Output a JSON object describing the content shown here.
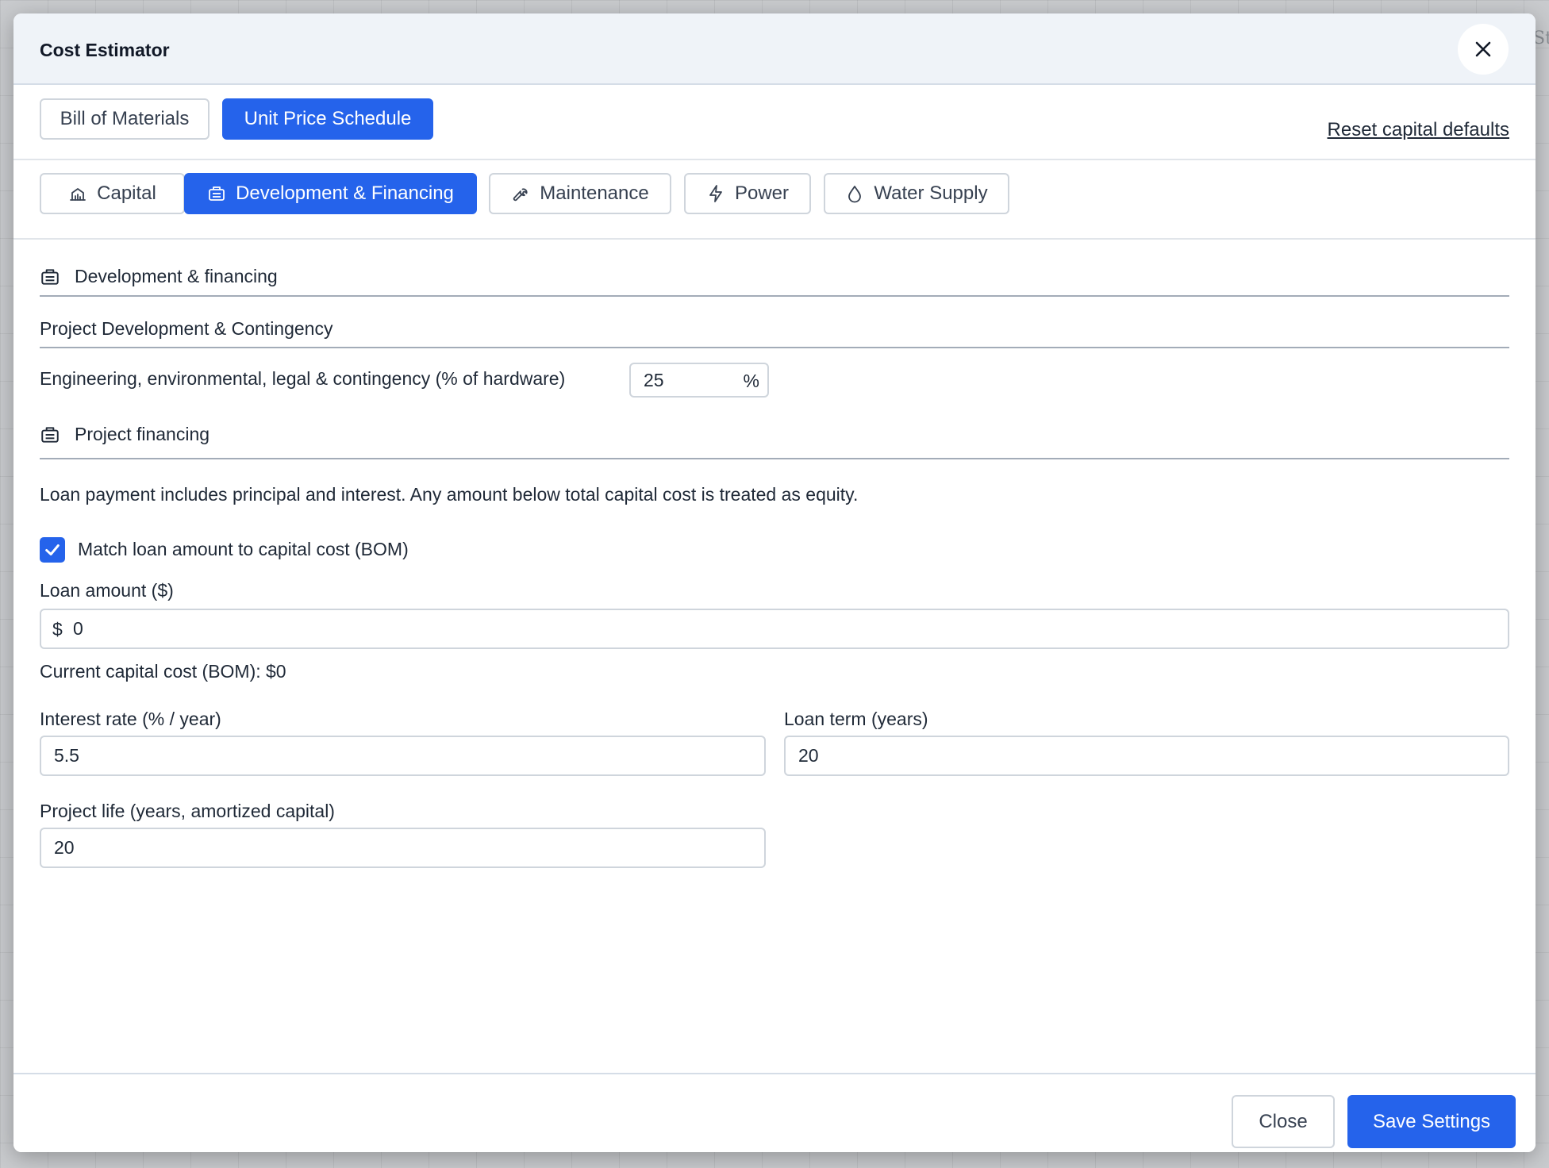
{
  "background": {
    "corner_text": "St"
  },
  "modal": {
    "title": "Cost Estimator",
    "close_icon": "close-icon"
  },
  "top_tabs": {
    "items": [
      {
        "label": "Bill of Materials",
        "active": false
      },
      {
        "label": "Unit Price Schedule",
        "active": true
      }
    ],
    "reset_link": "Reset capital defaults"
  },
  "sub_tabs": {
    "items": [
      {
        "label": "Capital",
        "icon": "building-bank-icon",
        "active": false
      },
      {
        "label": "Development & Financing",
        "icon": "briefcase-icon",
        "active": true
      },
      {
        "label": "Maintenance",
        "icon": "wrench-icon",
        "active": false
      },
      {
        "label": "Power",
        "icon": "lightning-bolt-icon",
        "active": false
      },
      {
        "label": "Water Supply",
        "icon": "water-drop-icon",
        "active": false
      }
    ]
  },
  "dev_financing": {
    "section_title": "Development & financing",
    "subsection_title": "Project Development & Contingency",
    "contingency": {
      "label": "Engineering, environmental, legal & contingency (% of hardware)",
      "value": "25",
      "suffix": "%"
    }
  },
  "project_financing": {
    "section_title": "Project financing",
    "note": "Loan payment includes principal and interest. Any amount below total capital cost is treated as equity.",
    "match_checkbox": {
      "label": "Match loan amount to capital cost (BOM)",
      "checked": true
    },
    "loan_amount": {
      "label": "Loan amount ($)",
      "prefix": "$",
      "value": "0"
    },
    "current_capital": "Current capital cost (BOM): $0",
    "interest_rate": {
      "label": "Interest rate (% / year)",
      "value": "5.5"
    },
    "loan_term": {
      "label": "Loan term (years)",
      "value": "20"
    },
    "project_life": {
      "label": "Project life (years, amortized capital)",
      "value": "20"
    }
  },
  "footer": {
    "close_label": "Close",
    "save_label": "Save Settings"
  },
  "colors": {
    "primary": "#2563eb",
    "header_bg": "#eff3f8",
    "border": "#cfd5dc"
  }
}
